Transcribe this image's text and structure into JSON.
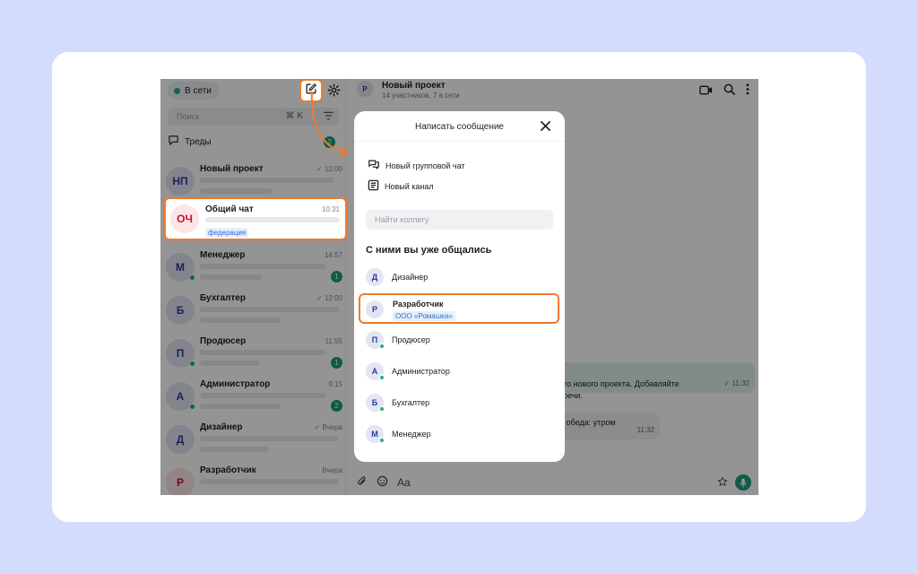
{
  "colors": {
    "accent": "#f17a2b",
    "green": "#1a9d7c",
    "link": "#2a6fd6"
  },
  "sidebar": {
    "status": "В сети",
    "search_placeholder": "Поиск",
    "search_hint": "⌘ K",
    "threads_label": "Треды",
    "threads_badge": "2",
    "chats": [
      {
        "initials": "НП",
        "name": "Новый проект",
        "time": "12:00",
        "read": true,
        "online": false,
        "badge": ""
      },
      {
        "initials": "ОЧ",
        "name": "Общий чат",
        "time": "10:31",
        "tag": "федерация"
      },
      {
        "initials": "М",
        "name": "Менеджер",
        "time": "14:57",
        "online": true,
        "badge": "1"
      },
      {
        "initials": "Б",
        "name": "Бухгалтер",
        "time": "12:00",
        "read": true,
        "online": false,
        "badge": ""
      },
      {
        "initials": "П",
        "name": "Продюсер",
        "time": "11:55",
        "online": true,
        "badge": "1"
      },
      {
        "initials": "А",
        "name": "Администратор",
        "time": "9:15",
        "online": true,
        "badge": "2"
      },
      {
        "initials": "Д",
        "name": "Дизайнер",
        "time": "Вчера",
        "read": true,
        "online": false,
        "badge": ""
      },
      {
        "initials": "Р",
        "name": "Разработчик",
        "time": "Вчера",
        "online": false,
        "badge": ""
      }
    ]
  },
  "chat": {
    "initial": "Р",
    "title": "Новый проект",
    "subtitle": "14 участников, 7 в сети",
    "msg1_text": "его нового проекта. Добавляйте\nтречи.",
    "msg1_time": "11:32",
    "msg2_text": "е обеда: утром",
    "msg2_time": "11:32",
    "day_fragment": "я",
    "format_label": "Aa"
  },
  "dialog": {
    "title": "Написать сообщение",
    "actions": [
      {
        "label": "Новый групповой чат",
        "icon": "chat-bubbles-icon"
      },
      {
        "label": "Новый канал",
        "icon": "channel-icon"
      }
    ],
    "search_placeholder": "Найти коллегу",
    "section_title": "С ними вы уже общались",
    "contacts": [
      {
        "initial": "Д",
        "name": "Дизайнер",
        "online": false
      },
      {
        "initial": "Р",
        "name": "Разработчик",
        "org": "ООО «Ромашка»"
      },
      {
        "initial": "П",
        "name": "Продюсер",
        "online": true
      },
      {
        "initial": "А",
        "name": "Администратор",
        "online": true
      },
      {
        "initial": "Б",
        "name": "Бухгалтер",
        "online": true
      },
      {
        "initial": "М",
        "name": "Менеджер",
        "online": true
      }
    ]
  }
}
